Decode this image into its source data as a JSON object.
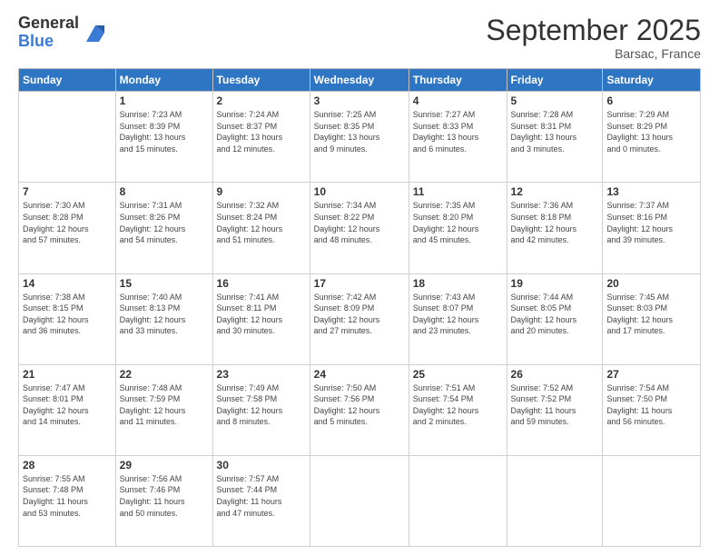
{
  "logo": {
    "general": "General",
    "blue": "Blue"
  },
  "header": {
    "month": "September 2025",
    "location": "Barsac, France"
  },
  "weekdays": [
    "Sunday",
    "Monday",
    "Tuesday",
    "Wednesday",
    "Thursday",
    "Friday",
    "Saturday"
  ],
  "weeks": [
    [
      {
        "day": "",
        "info": ""
      },
      {
        "day": "1",
        "info": "Sunrise: 7:23 AM\nSunset: 8:39 PM\nDaylight: 13 hours\nand 15 minutes."
      },
      {
        "day": "2",
        "info": "Sunrise: 7:24 AM\nSunset: 8:37 PM\nDaylight: 13 hours\nand 12 minutes."
      },
      {
        "day": "3",
        "info": "Sunrise: 7:25 AM\nSunset: 8:35 PM\nDaylight: 13 hours\nand 9 minutes."
      },
      {
        "day": "4",
        "info": "Sunrise: 7:27 AM\nSunset: 8:33 PM\nDaylight: 13 hours\nand 6 minutes."
      },
      {
        "day": "5",
        "info": "Sunrise: 7:28 AM\nSunset: 8:31 PM\nDaylight: 13 hours\nand 3 minutes."
      },
      {
        "day": "6",
        "info": "Sunrise: 7:29 AM\nSunset: 8:29 PM\nDaylight: 13 hours\nand 0 minutes."
      }
    ],
    [
      {
        "day": "7",
        "info": "Sunrise: 7:30 AM\nSunset: 8:28 PM\nDaylight: 12 hours\nand 57 minutes."
      },
      {
        "day": "8",
        "info": "Sunrise: 7:31 AM\nSunset: 8:26 PM\nDaylight: 12 hours\nand 54 minutes."
      },
      {
        "day": "9",
        "info": "Sunrise: 7:32 AM\nSunset: 8:24 PM\nDaylight: 12 hours\nand 51 minutes."
      },
      {
        "day": "10",
        "info": "Sunrise: 7:34 AM\nSunset: 8:22 PM\nDaylight: 12 hours\nand 48 minutes."
      },
      {
        "day": "11",
        "info": "Sunrise: 7:35 AM\nSunset: 8:20 PM\nDaylight: 12 hours\nand 45 minutes."
      },
      {
        "day": "12",
        "info": "Sunrise: 7:36 AM\nSunset: 8:18 PM\nDaylight: 12 hours\nand 42 minutes."
      },
      {
        "day": "13",
        "info": "Sunrise: 7:37 AM\nSunset: 8:16 PM\nDaylight: 12 hours\nand 39 minutes."
      }
    ],
    [
      {
        "day": "14",
        "info": "Sunrise: 7:38 AM\nSunset: 8:15 PM\nDaylight: 12 hours\nand 36 minutes."
      },
      {
        "day": "15",
        "info": "Sunrise: 7:40 AM\nSunset: 8:13 PM\nDaylight: 12 hours\nand 33 minutes."
      },
      {
        "day": "16",
        "info": "Sunrise: 7:41 AM\nSunset: 8:11 PM\nDaylight: 12 hours\nand 30 minutes."
      },
      {
        "day": "17",
        "info": "Sunrise: 7:42 AM\nSunset: 8:09 PM\nDaylight: 12 hours\nand 27 minutes."
      },
      {
        "day": "18",
        "info": "Sunrise: 7:43 AM\nSunset: 8:07 PM\nDaylight: 12 hours\nand 23 minutes."
      },
      {
        "day": "19",
        "info": "Sunrise: 7:44 AM\nSunset: 8:05 PM\nDaylight: 12 hours\nand 20 minutes."
      },
      {
        "day": "20",
        "info": "Sunrise: 7:45 AM\nSunset: 8:03 PM\nDaylight: 12 hours\nand 17 minutes."
      }
    ],
    [
      {
        "day": "21",
        "info": "Sunrise: 7:47 AM\nSunset: 8:01 PM\nDaylight: 12 hours\nand 14 minutes."
      },
      {
        "day": "22",
        "info": "Sunrise: 7:48 AM\nSunset: 7:59 PM\nDaylight: 12 hours\nand 11 minutes."
      },
      {
        "day": "23",
        "info": "Sunrise: 7:49 AM\nSunset: 7:58 PM\nDaylight: 12 hours\nand 8 minutes."
      },
      {
        "day": "24",
        "info": "Sunrise: 7:50 AM\nSunset: 7:56 PM\nDaylight: 12 hours\nand 5 minutes."
      },
      {
        "day": "25",
        "info": "Sunrise: 7:51 AM\nSunset: 7:54 PM\nDaylight: 12 hours\nand 2 minutes."
      },
      {
        "day": "26",
        "info": "Sunrise: 7:52 AM\nSunset: 7:52 PM\nDaylight: 11 hours\nand 59 minutes."
      },
      {
        "day": "27",
        "info": "Sunrise: 7:54 AM\nSunset: 7:50 PM\nDaylight: 11 hours\nand 56 minutes."
      }
    ],
    [
      {
        "day": "28",
        "info": "Sunrise: 7:55 AM\nSunset: 7:48 PM\nDaylight: 11 hours\nand 53 minutes."
      },
      {
        "day": "29",
        "info": "Sunrise: 7:56 AM\nSunset: 7:46 PM\nDaylight: 11 hours\nand 50 minutes."
      },
      {
        "day": "30",
        "info": "Sunrise: 7:57 AM\nSunset: 7:44 PM\nDaylight: 11 hours\nand 47 minutes."
      },
      {
        "day": "",
        "info": ""
      },
      {
        "day": "",
        "info": ""
      },
      {
        "day": "",
        "info": ""
      },
      {
        "day": "",
        "info": ""
      }
    ]
  ]
}
